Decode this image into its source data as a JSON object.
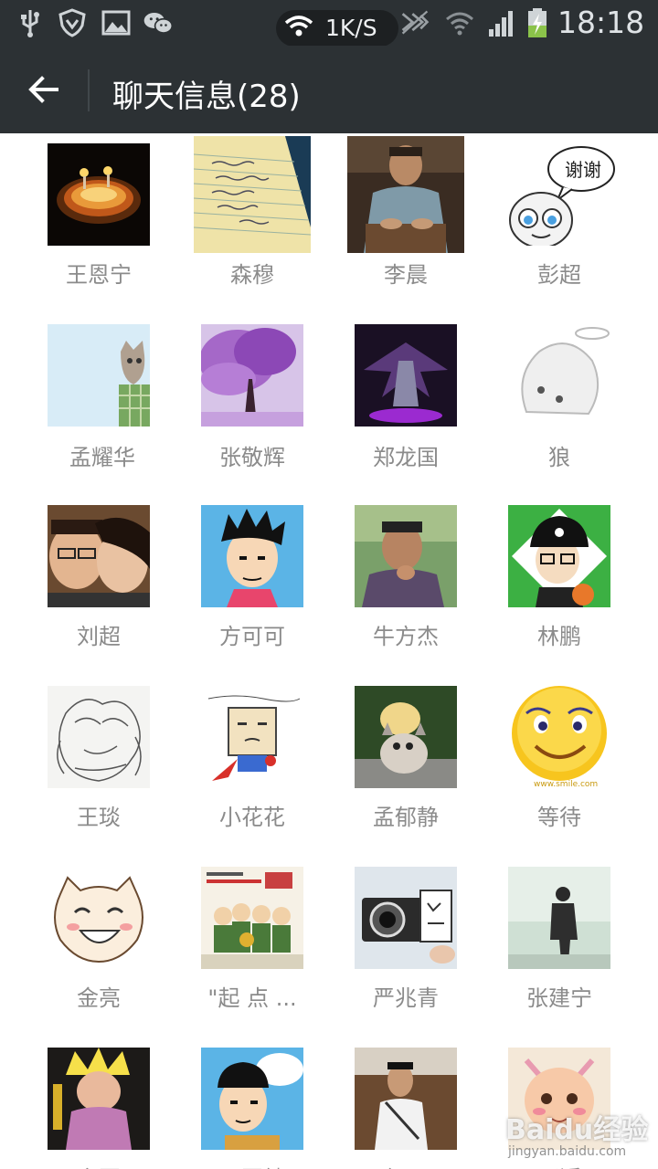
{
  "status_bar": {
    "net_speed": "1K/S",
    "time": "18:18",
    "icons": [
      "usb-icon",
      "shield-icon",
      "image-icon",
      "wechat-icon",
      "wifi-icon",
      "signal-blocked-icon",
      "wifi-icon",
      "signal-icon",
      "battery-charging-icon"
    ]
  },
  "header": {
    "back_icon": "back-arrow-icon",
    "title": "聊天信息(28)"
  },
  "members": [
    {
      "name": "王恩宁"
    },
    {
      "name": "森穆"
    },
    {
      "name": "李晨"
    },
    {
      "name": "彭超"
    },
    {
      "name": "孟耀华"
    },
    {
      "name": "张敬辉"
    },
    {
      "name": "郑龙国"
    },
    {
      "name": "狼"
    },
    {
      "name": "刘超"
    },
    {
      "name": "方可可"
    },
    {
      "name": "牛方杰"
    },
    {
      "name": "林鹏"
    },
    {
      "name": "王琰"
    },
    {
      "name": "小花花"
    },
    {
      "name": "孟郁静"
    },
    {
      "name": "等待"
    },
    {
      "name": "金亮"
    },
    {
      "name": "\"起 点 ..."
    },
    {
      "name": "严兆青"
    },
    {
      "name": "张建宁"
    },
    {
      "name": "宇图"
    },
    {
      "name": "马国健"
    },
    {
      "name": "纪玉"
    },
    {
      "name": "邓近"
    }
  ],
  "avatar_captions": {
    "thanks_bubble": "谢谢",
    "smile_site": "www.smile.com"
  },
  "watermark": {
    "brand": "Baidu经验",
    "url": "jingyan.baidu.com"
  }
}
